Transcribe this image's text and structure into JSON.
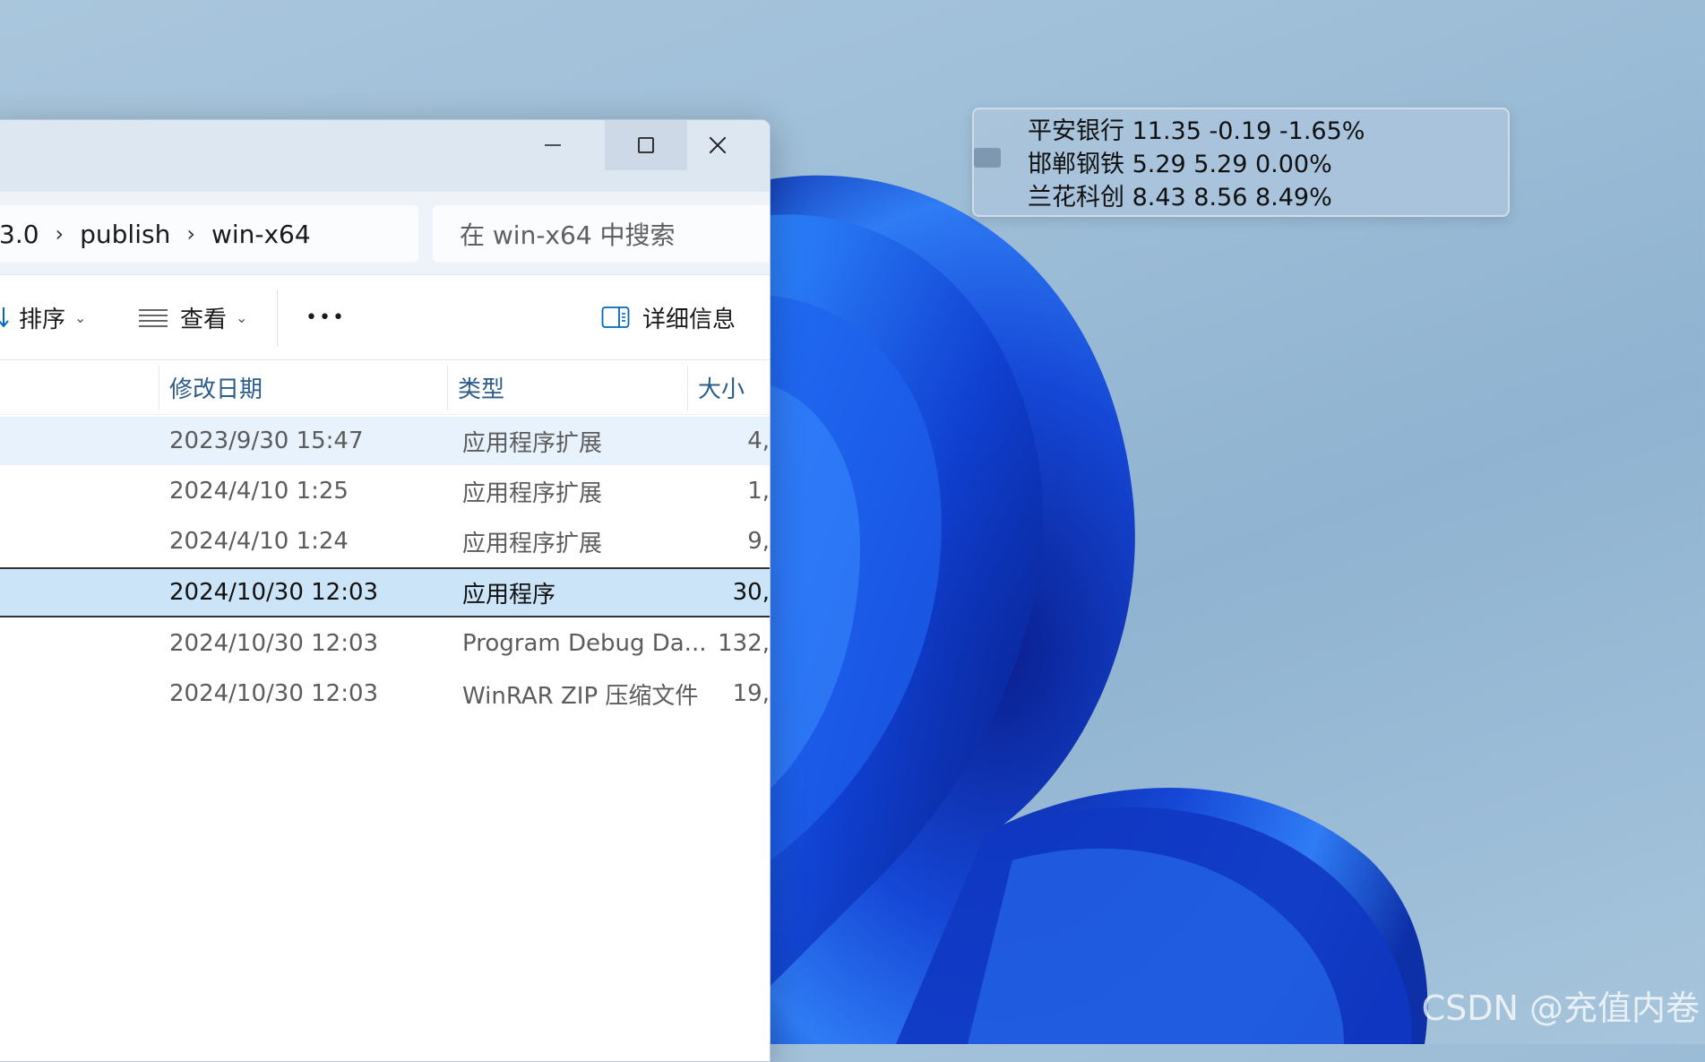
{
  "window": {
    "minimize_glyph": "—",
    "maximize_glyph": "☐",
    "close_glyph": "✕"
  },
  "breadcrumb": {
    "items": [
      "3.0",
      "publish",
      "win-x64"
    ],
    "separator": "›"
  },
  "search": {
    "placeholder": "在 win-x64 中搜索"
  },
  "toolbar": {
    "sort_label": "排序",
    "view_label": "查看",
    "more_label": "•••",
    "details_label": "详细信息"
  },
  "columns": {
    "modified": "修改日期",
    "type": "类型",
    "size": "大小"
  },
  "files": [
    {
      "date": "2023/9/30 15:47",
      "type": "应用程序扩展",
      "size": "4,",
      "state": "hover"
    },
    {
      "date": "2024/4/10 1:25",
      "type": "应用程序扩展",
      "size": "1,",
      "state": "normal"
    },
    {
      "date": "2024/4/10 1:24",
      "type": "应用程序扩展",
      "size": "9,",
      "state": "normal"
    },
    {
      "date": "2024/10/30 12:03",
      "type": "应用程序",
      "size": "30,",
      "state": "selected"
    },
    {
      "date": "2024/10/30 12:03",
      "type": "Program Debug Da...",
      "size": "132,",
      "state": "normal"
    },
    {
      "date": "2024/10/30 12:03",
      "type": "WinRAR ZIP 压缩文件",
      "size": "19,",
      "state": "normal"
    }
  ],
  "stock_widget": {
    "lines": [
      "平安银行 11.35 -0.19 -1.65%",
      "邯郸钢铁 5.29 5.29 0.00%",
      "兰花科创 8.43 8.56 8.49%"
    ]
  },
  "watermark": "CSDN @充值内卷",
  "colors": {
    "accent": "#0067c0",
    "selected_row": "#cce4f7",
    "hover_row": "#e8f2fc",
    "header_text": "#2c5d8a"
  }
}
